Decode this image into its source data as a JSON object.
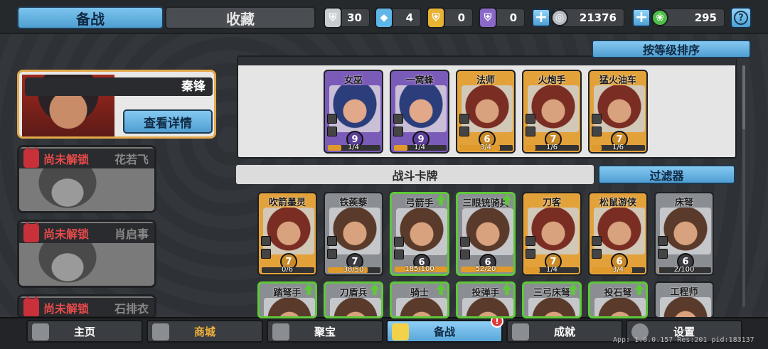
{
  "top": {
    "tab_prep": "备战",
    "tab_favorites": "收藏",
    "resources": [
      {
        "name": "silver-shield",
        "value": "30",
        "color": "#c9ccd1"
      },
      {
        "name": "blue-crystal",
        "value": "4",
        "color": "#5fb6e8"
      },
      {
        "name": "gold-shield",
        "value": "0",
        "color": "#e8b233"
      },
      {
        "name": "purple-shield",
        "value": "0",
        "color": "#8a68c8"
      }
    ],
    "coins": "21376",
    "gems": "295"
  },
  "hero": {
    "name": "秦锋",
    "detail_button": "查看详情"
  },
  "locked_heroes": [
    {
      "status": "尚未解锁",
      "name": "花若飞"
    },
    {
      "status": "尚未解锁",
      "name": "肖启事"
    },
    {
      "status": "尚未解锁",
      "name": "石排衣"
    }
  ],
  "sort_button": "按等级排序",
  "deck_cards": [
    {
      "name": "女巫",
      "level": "9",
      "progress": "1/4",
      "fill": 0.25,
      "rarity": "purple"
    },
    {
      "name": "一窝蜂",
      "level": "9",
      "progress": "1/4",
      "fill": 0.25,
      "rarity": "purple"
    },
    {
      "name": "法师",
      "level": "6",
      "progress": "3/4",
      "fill": 0.75,
      "rarity": "gold"
    },
    {
      "name": "火炮手",
      "level": "7",
      "progress": "1/6",
      "fill": 0.17,
      "rarity": "gold"
    },
    {
      "name": "猛火油车",
      "level": "7",
      "progress": "1/6",
      "fill": 0.17,
      "rarity": "gold"
    }
  ],
  "section_title": "战斗卡牌",
  "filter_button": "过滤器",
  "battle_cards": [
    {
      "name": "吹箭墨灵",
      "level": "7",
      "progress": "0/6",
      "fill": 0.0,
      "rarity": "gold",
      "upgradable": false
    },
    {
      "name": "铁蒺藜",
      "level": "7",
      "progress": "38/50",
      "fill": 0.76,
      "rarity": "grey",
      "upgradable": false
    },
    {
      "name": "弓箭手",
      "level": "6",
      "progress": "185/100",
      "fill": 1.0,
      "rarity": "grey",
      "upgradable": true
    },
    {
      "name": "三眼铳骑兵",
      "level": "6",
      "progress": "52/20",
      "fill": 1.0,
      "rarity": "grey",
      "upgradable": true
    },
    {
      "name": "刀客",
      "level": "7",
      "progress": "1/4",
      "fill": 0.25,
      "rarity": "gold",
      "upgradable": false
    },
    {
      "name": "松鼠游侠",
      "level": "6",
      "progress": "3/4",
      "fill": 0.75,
      "rarity": "gold",
      "upgradable": false
    },
    {
      "name": "床弩",
      "level": "6",
      "progress": "2/100",
      "fill": 0.02,
      "rarity": "grey",
      "upgradable": false
    }
  ],
  "partial_cards": [
    {
      "name": "踏弩手",
      "upgradable": true
    },
    {
      "name": "刀盾兵",
      "upgradable": true
    },
    {
      "name": "骑士",
      "upgradable": true
    },
    {
      "name": "投弹手",
      "upgradable": true
    },
    {
      "name": "三弓床弩",
      "upgradable": true
    },
    {
      "name": "投石弩",
      "upgradable": true
    },
    {
      "name": "工程师",
      "upgradable": false
    }
  ],
  "nav": [
    {
      "label": "主页",
      "icon": "home-icon"
    },
    {
      "label": "商城",
      "icon": "shop-icon"
    },
    {
      "label": "聚宝",
      "icon": "treasure-icon"
    },
    {
      "label": "备战",
      "icon": "deck-icon"
    },
    {
      "label": "成就",
      "icon": "achievement-icon"
    },
    {
      "label": "设置",
      "icon": "settings-icon"
    }
  ],
  "nav_badge": "!",
  "version": "App: 1.0.0.157 Res:201 pid:183137"
}
